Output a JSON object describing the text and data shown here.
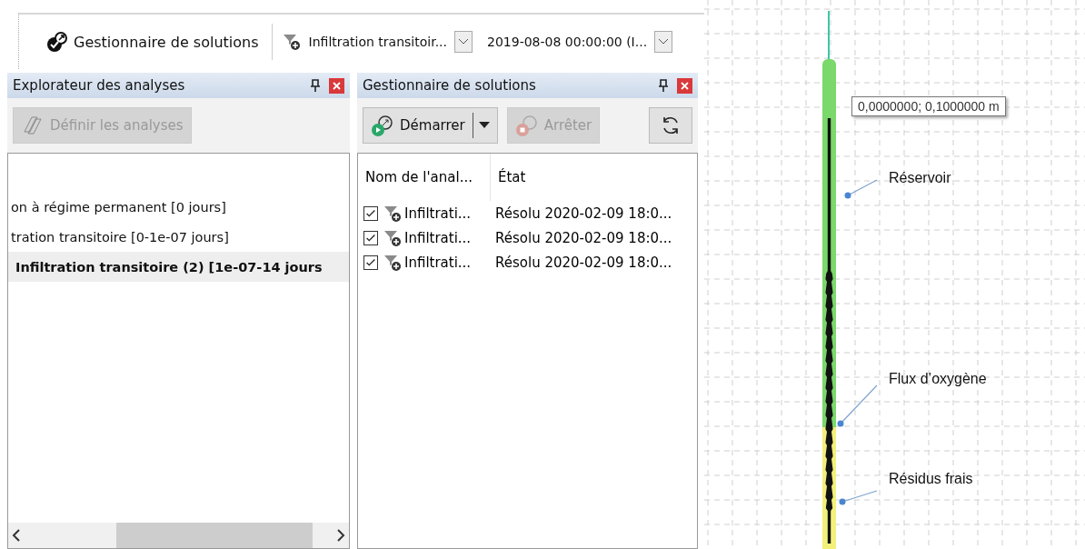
{
  "toolbar": {
    "title": "Gestionnaire de solutions",
    "analysis_combo": "Infiltration transitoir...",
    "time_combo": "2019-08-08 00:00:00 (I..."
  },
  "analysis_explorer": {
    "title": "Explorateur des analyses",
    "define_button": {
      "label": "Définir les analyses",
      "disabled": true
    },
    "items": [
      {
        "label": "on à régime permanent [0 jours]",
        "selected": false
      },
      {
        "label": "tration transitoire [0-1e-07 jours]",
        "selected": false
      },
      {
        "label": "Infiltration transitoire (2) [1e-07-14 jours",
        "selected": true
      }
    ]
  },
  "solution_manager": {
    "title": "Gestionnaire de solutions",
    "start_button": {
      "label": "Démarrer",
      "disabled": false
    },
    "stop_button": {
      "label": "Arrêter",
      "disabled": true
    },
    "columns": [
      "Nom de l'anal...",
      "État"
    ],
    "rows": [
      {
        "checked": true,
        "name": "Infiltrati...",
        "state": "Résolu 2020-02-09 18:0..."
      },
      {
        "checked": true,
        "name": "Infiltrati...",
        "state": "Résolu 2020-02-09 18:0..."
      },
      {
        "checked": true,
        "name": "Infiltrati...",
        "state": "Résolu 2020-02-09 18:0..."
      }
    ]
  },
  "canvas": {
    "tooltip": "0,0000000; 0,1000000 m",
    "annotations": [
      {
        "label": "Réservoir"
      },
      {
        "label": "Flux d’oxygène"
      },
      {
        "label": "Résidus frais"
      }
    ]
  }
}
